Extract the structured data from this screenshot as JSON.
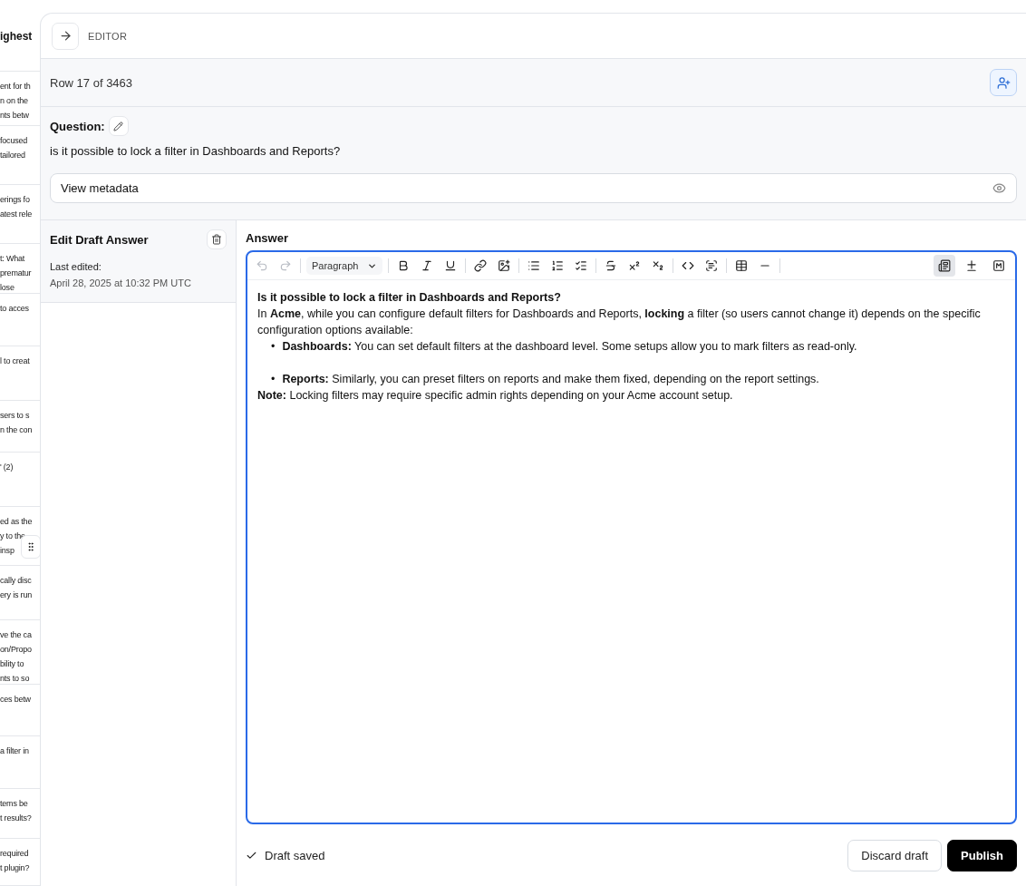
{
  "background_list": {
    "header": "ighest",
    "rows": [
      [
        "ent for th",
        "n on the",
        "nts betw"
      ],
      [
        "focused",
        "tailored"
      ],
      [
        "erings fo",
        "atest rele"
      ],
      [
        "t: What",
        "prematur",
        "lose"
      ],
      [
        "to acces"
      ],
      [
        "l to creat"
      ],
      [
        "sers to s",
        "n the con"
      ],
      [
        "' (2)"
      ],
      [
        "ed as the",
        "y to the",
        "insp"
      ],
      [
        "cally disc",
        "ery is run"
      ],
      [
        "ve the ca",
        "on/Propo",
        "bility to",
        "nts to so"
      ],
      [
        "ces betw"
      ],
      [
        "a filter in"
      ],
      [
        "tems be",
        "t results?"
      ],
      [
        "required",
        "t plugin?"
      ]
    ]
  },
  "editor": {
    "title": "EDITOR",
    "row_counter": "Row 17 of 3463",
    "question_label": "Question:",
    "question": "is it possible to lock a filter in Dashboards and Reports?",
    "metadata_button": "View metadata",
    "draft_title": "Edit Draft Answer",
    "last_edited_label": "Last edited:",
    "last_edited": "April 28, 2025 at 10:32 PM UTC",
    "answer_label": "Answer",
    "toolbar": [
      {
        "kind": "undo",
        "disabled": true
      },
      {
        "kind": "redo",
        "disabled": true
      },
      {
        "kind": "sep"
      },
      {
        "kind": "block",
        "label": "Paragraph"
      },
      {
        "kind": "sep"
      },
      {
        "kind": "bold",
        "disabled": false
      },
      {
        "kind": "italic",
        "disabled": false
      },
      {
        "kind": "underline",
        "disabled": false
      },
      {
        "kind": "sep"
      },
      {
        "kind": "link",
        "disabled": false
      },
      {
        "kind": "image",
        "disabled": false
      },
      {
        "kind": "sep"
      },
      {
        "kind": "bullets",
        "disabled": false
      },
      {
        "kind": "numbers",
        "disabled": false
      },
      {
        "kind": "checklist",
        "disabled": false
      },
      {
        "kind": "sep"
      },
      {
        "kind": "strike",
        "disabled": false
      },
      {
        "kind": "superscript",
        "disabled": false
      },
      {
        "kind": "subscript",
        "disabled": false
      },
      {
        "kind": "sep"
      },
      {
        "kind": "code",
        "disabled": false
      },
      {
        "kind": "codeblock",
        "disabled": false
      },
      {
        "kind": "sep"
      },
      {
        "kind": "table",
        "disabled": false
      },
      {
        "kind": "rule",
        "disabled": false
      },
      {
        "kind": "sep"
      }
    ],
    "view_modes": [
      {
        "kind": "rich",
        "selected": true
      },
      {
        "kind": "diff",
        "selected": false
      },
      {
        "kind": "markdown",
        "selected": false
      }
    ],
    "content": [
      {
        "kind": "para",
        "text": "**Is it possible to lock a filter in Dashboards and Reports?**"
      },
      {
        "kind": "para",
        "text": "In **Acme**, while you can configure default filters for Dashboards and Reports, **locking** a filter (so users cannot change it) depends on the specific configuration options available:"
      },
      {
        "kind": "bullet",
        "marker": "•",
        "text": "**Dashboards:** You can set default filters at the dashboard level. Some setups allow you to mark filters as read-only."
      },
      {
        "kind": "bullet",
        "marker": "•",
        "text": "**Reports:** Similarly, you can preset filters on reports and make them fixed, depending on the report settings."
      },
      {
        "kind": "para",
        "text": "**Note:** Locking filters may require specific admin rights depending on your Acme account setup."
      }
    ],
    "status": "Draft saved",
    "discard_button": "Discard draft",
    "publish_button": "Publish"
  }
}
